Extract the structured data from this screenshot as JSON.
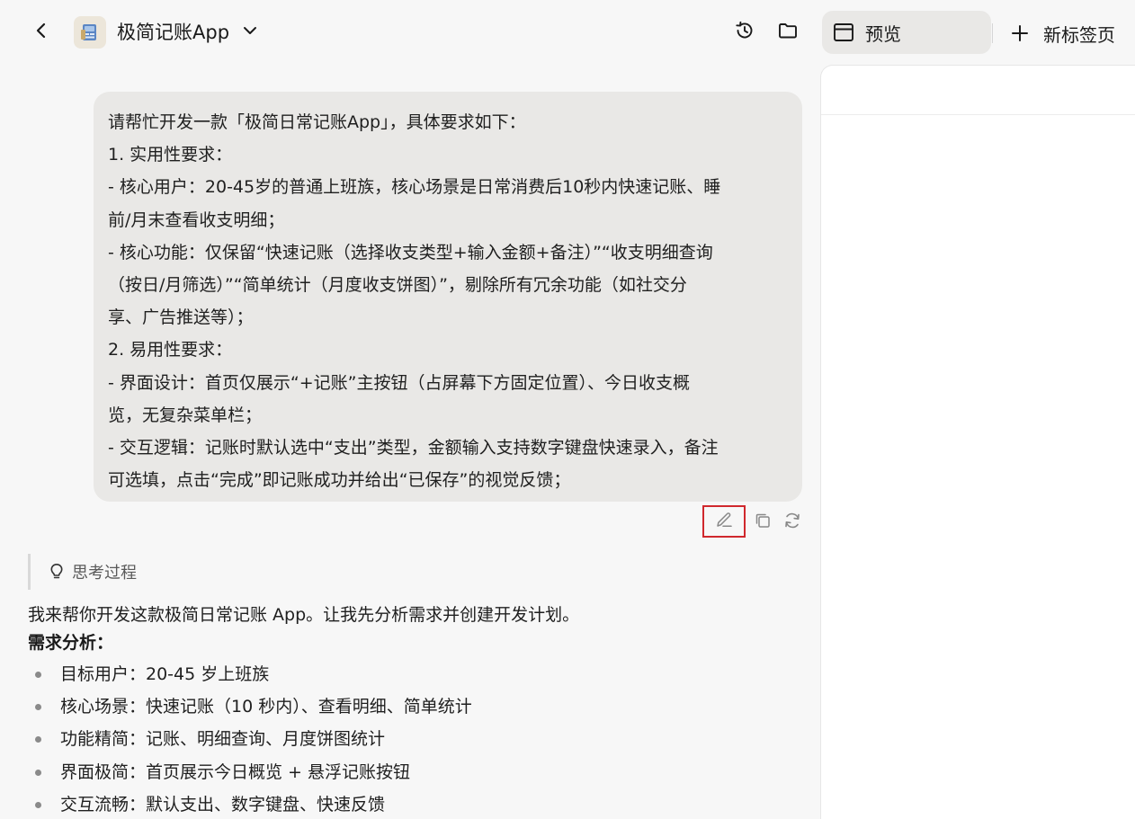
{
  "header": {
    "app_title": "极简记账App",
    "icons": {
      "back": "chevron-left-icon",
      "app": "app-icon",
      "dropdown": "chevron-down-icon",
      "history": "history-icon",
      "folder": "folder-icon"
    }
  },
  "tabs": {
    "preview_label": "预览",
    "new_tab_label": "新标签页"
  },
  "user_message": {
    "lines": [
      "请帮忙开发一款「极简日常记账App」，具体要求如下：",
      "1. 实用性要求：",
      "- 核心用户：20-45岁的普通上班族，核心场景是日常消费后10秒内快速记账、睡",
      "前/月末查看收支明细；",
      "- 核心功能：仅保留“快速记账（选择收支类型+输入金额+备注）”“收支明细查询",
      "（按日/月筛选）”“简单统计（月度收支饼图）”，剔除所有冗余功能（如社交分",
      "享、广告推送等）；",
      "2. 易用性要求：",
      "- 界面设计：首页仅展示“+记账”主按钮（占屏幕下方固定位置）、今日收支概",
      "览，无复杂菜单栏；",
      "- 交互逻辑：记账时默认选中“支出”类型，金额输入支持数字键盘快速录入，备注",
      "可选填，点击“完成”即记账成功并给出“已保存”的视觉反馈；"
    ],
    "actions": [
      "edit-icon",
      "copy-icon",
      "refresh-icon"
    ]
  },
  "thinking": {
    "label": "思考过程"
  },
  "assistant": {
    "intro": "我来帮你开发这款极简日常记账 App。让我先分析需求并创建开发计划。",
    "heading": "需求分析：",
    "items": [
      "目标用户：20-45 岁上班族",
      "核心场景：快速记账（10 秒内）、查看明细、简单统计",
      "功能精简：记账、明细查询、月度饼图统计",
      "界面极简：首页展示今日概览 + 悬浮记账按钮",
      "交互流畅：默认支出、数字键盘、快速反馈"
    ]
  },
  "colors": {
    "page_bg": "#f7f7f7",
    "bubble_bg": "#e9e8e6",
    "highlight": "#d0282d"
  }
}
